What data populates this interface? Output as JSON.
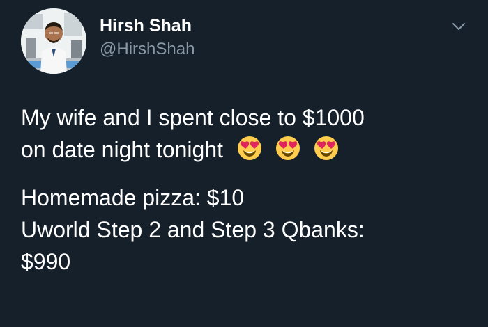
{
  "tweet": {
    "author": {
      "display_name": "Hirsh Shah",
      "handle": "@HirshShah",
      "avatar_icon": "profile-photo-avatar"
    },
    "menu_icon": "chevron-down-icon",
    "text": {
      "line1": "My wife and I spent close to $1000",
      "line2": "on date night tonight",
      "emoji_icons": [
        "heart-eyes-emoji",
        "heart-eyes-emoji",
        "heart-eyes-emoji"
      ],
      "line3": "Homemade pizza: $10",
      "line4": "Uworld Step 2 and Step 3 Qbanks:",
      "line5": "$990"
    }
  },
  "colors": {
    "background": "#15202b",
    "text_primary": "#ffffff",
    "text_secondary": "#8899a6"
  }
}
